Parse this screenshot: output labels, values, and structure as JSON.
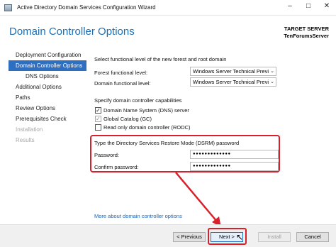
{
  "window": {
    "title": "Active Directory Domain Services Configuration Wizard",
    "minimize": "–",
    "maximize": "□",
    "close": "✕"
  },
  "header": {
    "page_title": "Domain Controller Options",
    "target_label": "TARGET SERVER",
    "target_server": "TenForumsServer"
  },
  "nav": {
    "items": [
      {
        "label": "Deployment Configuration",
        "state": "normal"
      },
      {
        "label": "Domain Controller Options",
        "state": "active"
      },
      {
        "label": "DNS Options",
        "state": "sub"
      },
      {
        "label": "Additional Options",
        "state": "normal"
      },
      {
        "label": "Paths",
        "state": "normal"
      },
      {
        "label": "Review Options",
        "state": "normal"
      },
      {
        "label": "Prerequisites Check",
        "state": "normal"
      },
      {
        "label": "Installation",
        "state": "disabled"
      },
      {
        "label": "Results",
        "state": "disabled"
      }
    ]
  },
  "content": {
    "functional_heading": "Select functional level of the new forest and root domain",
    "forest_label": "Forest functional level:",
    "forest_value": "Windows Server Technical Previe",
    "domain_label": "Domain functional level:",
    "domain_value": "Windows Server Technical Previe",
    "capabilities_heading": "Specify domain controller capabilities",
    "capabilities": [
      {
        "label": "Domain Name System (DNS) server",
        "checked": true,
        "enabled": true
      },
      {
        "label": "Global Catalog (GC)",
        "checked": true,
        "enabled": false
      },
      {
        "label": "Read only domain controller (RODC)",
        "checked": false,
        "enabled": true
      }
    ],
    "dsrm_heading": "Type the Directory Services Restore Mode (DSRM) password",
    "password_label": "Password:",
    "password_value": "●●●●●●●●●●●●●",
    "confirm_label": "Confirm password:",
    "confirm_value": "●●●●●●●●●●●●●",
    "more_link": "More about domain controller options"
  },
  "footer": {
    "previous": "< Previous",
    "next": "Next >",
    "install": "Install",
    "cancel": "Cancel"
  },
  "colors": {
    "accent": "#1c6fb5",
    "nav_active": "#2e6fc1",
    "annotation_red": "#d9202a"
  }
}
